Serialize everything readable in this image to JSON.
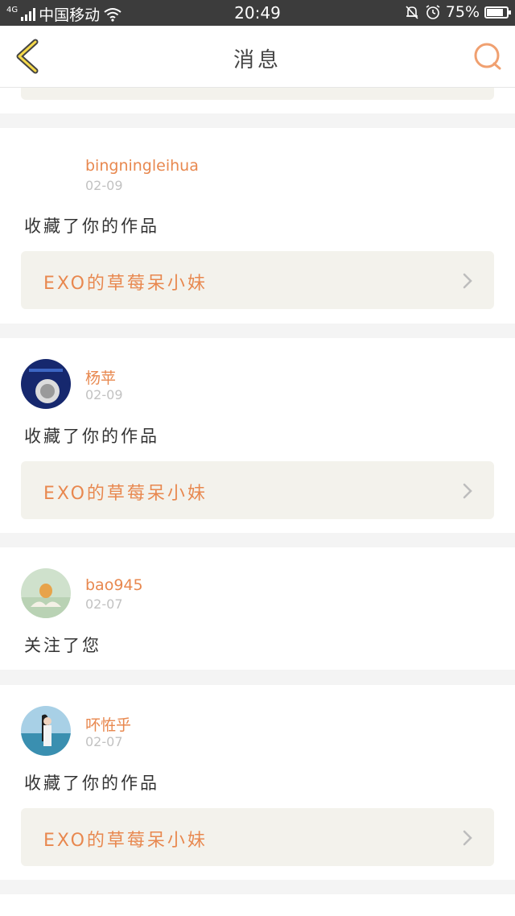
{
  "status_bar": {
    "network": "4G",
    "carrier": "中国移动",
    "time": "20:49",
    "battery": "75%",
    "battery_level": 0.75
  },
  "nav": {
    "title": "消息"
  },
  "messages": [
    {
      "user": "bingningleihua",
      "date": "02-09",
      "action": "收藏了你的作品",
      "work": "EXO的草莓呆小妹"
    },
    {
      "user": "杨苹",
      "date": "02-09",
      "action": "收藏了你的作品",
      "work": "EXO的草莓呆小妹"
    },
    {
      "user": "bao945",
      "date": "02-07",
      "action": "关注了您"
    },
    {
      "user": "吥恠乎",
      "date": "02-07",
      "action": "收藏了你的作品",
      "work": "EXO的草莓呆小妹"
    }
  ],
  "colors": {
    "accent": "#e8884f",
    "status_bar": "#3c3c3c",
    "card_bg": "#ffffff",
    "work_bg": "#f3f2ec",
    "page_bg": "#f4f4f4"
  }
}
